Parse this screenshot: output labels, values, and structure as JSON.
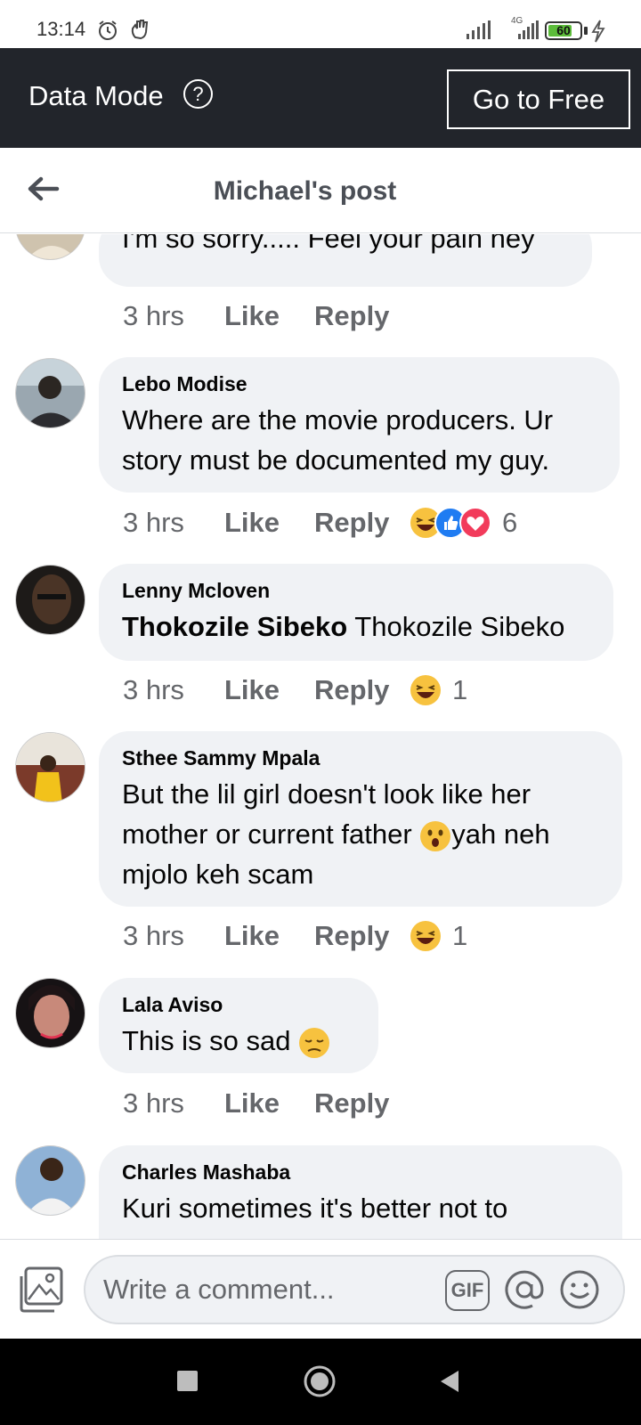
{
  "status_bar": {
    "time": "13:14",
    "battery": "60",
    "network": "4G"
  },
  "data_mode": {
    "label": "Data Mode",
    "help_icon": "?",
    "free_button": "Go to Free"
  },
  "nav": {
    "title": "Michael's post",
    "back_icon": "arrow-left-icon"
  },
  "comments": [
    {
      "author": "",
      "text": "I'm so sorry..... Feel your pain hey",
      "time": "3 hrs",
      "like": "Like",
      "reply": "Reply",
      "reactions": [],
      "reaction_count": ""
    },
    {
      "author": "Lebo Modise",
      "text": "Where are the movie producers. Ur story must be documented my guy.",
      "time": "3 hrs",
      "like": "Like",
      "reply": "Reply",
      "reactions": [
        "haha",
        "like",
        "love"
      ],
      "reaction_count": "6"
    },
    {
      "author": "Lenny Mcloven",
      "mention": "Thokozile Sibeko",
      "text": " Thokozile Sibeko",
      "time": "3 hrs",
      "like": "Like",
      "reply": "Reply",
      "reactions": [
        "haha"
      ],
      "reaction_count": "1"
    },
    {
      "author": "Sthee Sammy Mpala",
      "text": "But the lil girl doesn't look like her mother or current father",
      "text_after": "yah neh mjolo keh scam",
      "time": "3 hrs",
      "like": "Like",
      "reply": "Reply",
      "reactions": [
        "haha"
      ],
      "reaction_count": "1"
    },
    {
      "author": "Lala Aviso",
      "text": "This is so sad",
      "time": "3 hrs",
      "like": "Like",
      "reply": "Reply",
      "reactions": [],
      "reaction_count": ""
    },
    {
      "author": "Charles Mashaba",
      "text": "Kuri sometimes it's better not to",
      "time": "",
      "like": "",
      "reply": "",
      "reactions": [],
      "reaction_count": ""
    }
  ],
  "composer": {
    "placeholder": "Write a comment...",
    "gif_label": "GIF"
  },
  "colors": {
    "header_bg": "#22252b",
    "bubble_bg": "#f0f2f5",
    "meta_text": "#65676b"
  }
}
